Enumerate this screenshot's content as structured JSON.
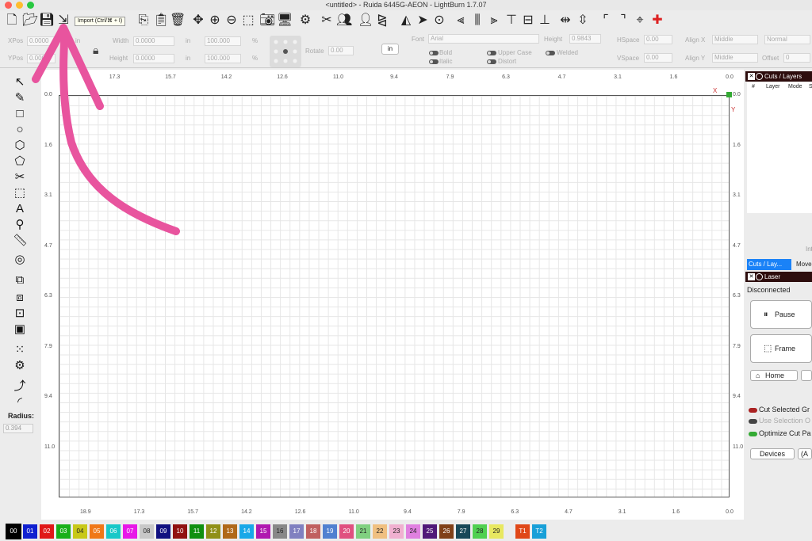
{
  "window": {
    "title": "<untitled> - Ruida 6445G-AEON - LightBurn 1.7.07"
  },
  "toolbar": {
    "tooltip": "Import (Ctrl/⌘ + I)",
    "icons": [
      "new-file-icon",
      "open-file-icon",
      "save-icon",
      "import-icon",
      "copy-icon",
      "paste-icon",
      "trash-icon",
      "move-icon",
      "zoom-in-icon",
      "zoom-out-icon",
      "frame-selection-icon",
      "camera-icon",
      "monitor-icon",
      "settings-icon",
      "tools-icon",
      "users-icon",
      "user-icon",
      "mirror-icon",
      "mirror-v-icon",
      "send-icon",
      "target-icon",
      "align-left-icon",
      "align-hcenter-icon",
      "align-right-icon",
      "align-top-icon",
      "align-vcenter-icon",
      "align-bottom-icon",
      "dist-h-icon",
      "dist-v-icon",
      "corner-tl-icon",
      "corner-tr-icon",
      "center-icon",
      "corner-marker-icon"
    ]
  },
  "props": {
    "xpos_label": "XPos",
    "xpos_value": "0.0000",
    "xpos_unit": "in",
    "ypos_label": "YPos",
    "ypos_value": "0.0000",
    "ypos_unit": "in",
    "width_label": "Width",
    "width_value": "0.0000",
    "width_unit": "in",
    "height_label": "Height",
    "height_value": "0.0000",
    "height_unit": "in",
    "scale_w": "100.000",
    "scale_h": "100.000",
    "pct": "%",
    "rotate_label": "Rotate",
    "rotate_value": "0.00",
    "units_button": "in",
    "font_label": "Font",
    "font_value": "Arial",
    "fheight_label": "Height",
    "fheight_value": "0.9843",
    "hspace_label": "HSpace",
    "hspace_value": "0.00",
    "vspace_label": "VSpace",
    "vspace_value": "0.00",
    "alignx_label": "Align X",
    "alignx_value": "Middle",
    "aligny_label": "Align Y",
    "aligny_value": "Middle",
    "normal_value": "Normal",
    "offset_label": "Offset",
    "offset_value": "0",
    "bold": "Bold",
    "italic": "Italic",
    "upper": "Upper Case",
    "distort": "Distort",
    "welded": "Welded"
  },
  "lefttools": {
    "icons": [
      "select-icon",
      "pencil-icon",
      "rectangle-icon",
      "ellipse-icon",
      "polygon-icon",
      "pentagon-icon",
      "scissors-icon",
      "dashed-rect-icon",
      "text-icon",
      "location-pin-icon",
      "ruler-icon",
      "offset-icon",
      "boolean-union-icon",
      "boolean-diff-icon",
      "boolean-intersect-icon",
      "weld-icon",
      "array-icon",
      "circular-array-icon",
      "node-edit-icon",
      "corner-radius-icon"
    ],
    "radius_label": "Radius:",
    "radius_value": "0.394"
  },
  "canvas": {
    "top_ruler": [
      "17.3",
      "15.7",
      "14.2",
      "12.6",
      "11.0",
      "9.4",
      "7.9",
      "6.3",
      "4.7",
      "3.1",
      "1.6",
      "0.0"
    ],
    "bottom_ruler": [
      "18.9",
      "17.3",
      "15.7",
      "14.2",
      "12.6",
      "11.0",
      "9.4",
      "7.9",
      "6.3",
      "4.7",
      "3.1",
      "1.6",
      "0.0"
    ],
    "left_ruler": [
      "0.0",
      "1.6",
      "3.1",
      "4.7",
      "6.3",
      "7.9",
      "9.4",
      "11.0"
    ],
    "x_label": "X",
    "y_label": "Y"
  },
  "rightpanel": {
    "cuts_title": "Cuts / Layers",
    "cols": [
      "#",
      "Layer",
      "Mode",
      "S"
    ],
    "int_label": "Int",
    "tabs": [
      "Cuts / Lay...",
      "Move"
    ],
    "laser_title": "Laser",
    "status": "Disconnected",
    "pause": "Pause",
    "frame": "Frame",
    "home": "Home",
    "cut_selected": "Cut Selected Gr",
    "use_selection": "Use Selection O",
    "optimize": "Optimize Cut Pa",
    "devices": "Devices",
    "auto": "(A"
  },
  "palette": [
    {
      "label": "00",
      "color": "#000000"
    },
    {
      "label": "01",
      "color": "#1020d0"
    },
    {
      "label": "02",
      "color": "#e01818"
    },
    {
      "label": "03",
      "color": "#18b018"
    },
    {
      "label": "04",
      "color": "#c8c818"
    },
    {
      "label": "05",
      "color": "#f07818"
    },
    {
      "label": "06",
      "color": "#18c8c8"
    },
    {
      "label": "07",
      "color": "#e818e8"
    },
    {
      "label": "08",
      "color": "#c8c8c8"
    },
    {
      "label": "09",
      "color": "#101080"
    },
    {
      "label": "10",
      "color": "#901010"
    },
    {
      "label": "11",
      "color": "#109010"
    },
    {
      "label": "12",
      "color": "#909018"
    },
    {
      "label": "13",
      "color": "#b06818"
    },
    {
      "label": "14",
      "color": "#18a8e8"
    },
    {
      "label": "15",
      "color": "#b018b0"
    },
    {
      "label": "16",
      "color": "#888888"
    },
    {
      "label": "17",
      "color": "#8080c0"
    },
    {
      "label": "18",
      "color": "#c06060"
    },
    {
      "label": "19",
      "color": "#5080d0"
    },
    {
      "label": "20",
      "color": "#e05080"
    },
    {
      "label": "21",
      "color": "#80d080"
    },
    {
      "label": "22",
      "color": "#f0c080"
    },
    {
      "label": "23",
      "color": "#f0b0d0"
    },
    {
      "label": "24",
      "color": "#e080e0"
    },
    {
      "label": "25",
      "color": "#501878"
    },
    {
      "label": "26",
      "color": "#804018"
    },
    {
      "label": "27",
      "color": "#184858"
    },
    {
      "label": "28",
      "color": "#50d050"
    },
    {
      "label": "29",
      "color": "#e8e860"
    },
    {
      "label": "T1",
      "color": "#e04818"
    },
    {
      "label": "T2",
      "color": "#18a0d8"
    }
  ]
}
